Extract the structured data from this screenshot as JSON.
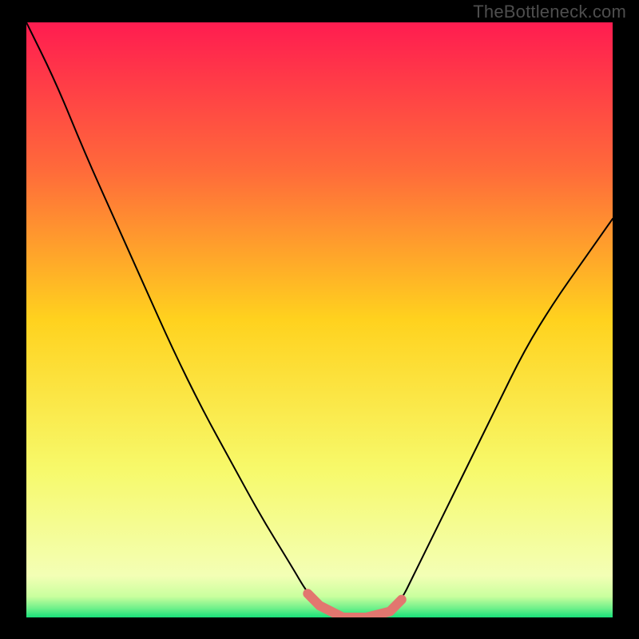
{
  "watermark": "TheBottleneck.com",
  "chart_data": {
    "type": "line",
    "title": "",
    "xlabel": "",
    "ylabel": "",
    "xlim": [
      0,
      1
    ],
    "ylim": [
      0,
      1
    ],
    "curve": {
      "name": "bottleneck-curve",
      "x": [
        0.0,
        0.05,
        0.1,
        0.15,
        0.2,
        0.25,
        0.3,
        0.35,
        0.4,
        0.45,
        0.48,
        0.5,
        0.54,
        0.58,
        0.62,
        0.64,
        0.66,
        0.7,
        0.75,
        0.8,
        0.85,
        0.9,
        0.95,
        1.0
      ],
      "y": [
        1.0,
        0.9,
        0.78,
        0.67,
        0.56,
        0.45,
        0.35,
        0.26,
        0.17,
        0.09,
        0.04,
        0.02,
        0.0,
        0.0,
        0.01,
        0.03,
        0.07,
        0.15,
        0.25,
        0.35,
        0.45,
        0.53,
        0.6,
        0.67
      ]
    },
    "optimal_segment": {
      "name": "optimal-band",
      "x": [
        0.48,
        0.5,
        0.54,
        0.58,
        0.62,
        0.64
      ],
      "y": [
        0.04,
        0.02,
        0.0,
        0.0,
        0.01,
        0.03
      ],
      "color": "#e2766f"
    },
    "background": {
      "type": "vertical-gradient",
      "stops": [
        {
          "pos": 0.0,
          "color": "#ff1c50"
        },
        {
          "pos": 0.25,
          "color": "#ff6b3a"
        },
        {
          "pos": 0.5,
          "color": "#ffd21e"
        },
        {
          "pos": 0.75,
          "color": "#f7f96a"
        },
        {
          "pos": 0.93,
          "color": "#f3ffb5"
        },
        {
          "pos": 0.965,
          "color": "#c9ff9e"
        },
        {
          "pos": 0.985,
          "color": "#6df08a"
        },
        {
          "pos": 1.0,
          "color": "#18e07a"
        }
      ]
    }
  }
}
